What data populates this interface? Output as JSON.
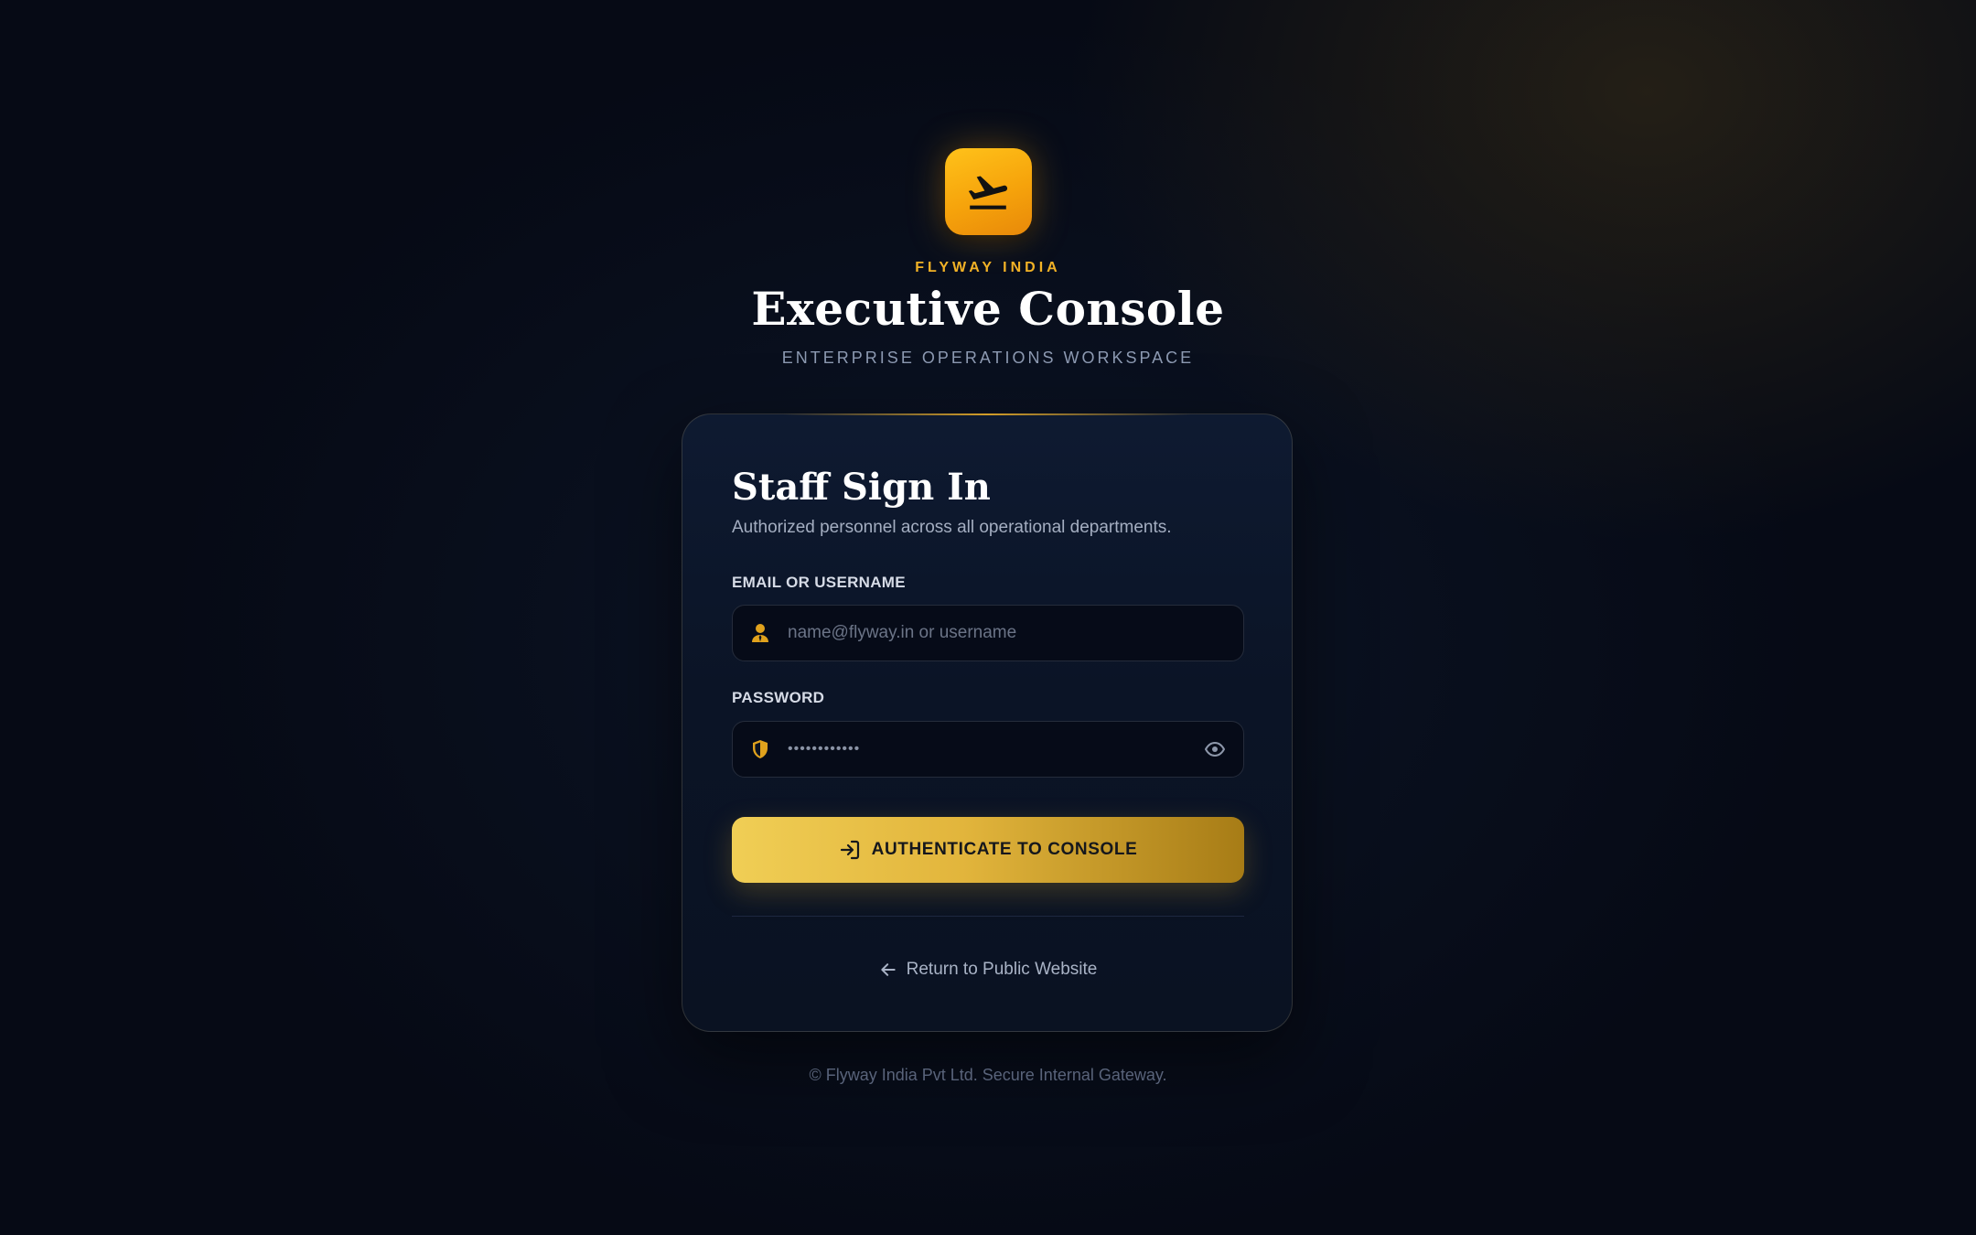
{
  "brand": {
    "name": "FLYWAY INDIA",
    "title": "Executive Console",
    "subtitle": "ENTERPRISE OPERATIONS WORKSPACE",
    "logo_icon": "plane-departure-icon"
  },
  "signin": {
    "title": "Staff Sign In",
    "description": "Authorized personnel across all operational departments.",
    "email": {
      "label": "EMAIL OR USERNAME",
      "placeholder": "name@flyway.in or username",
      "value": "",
      "icon": "user-icon"
    },
    "password": {
      "label": "PASSWORD",
      "masked_value": "••••••••••••",
      "icon": "shield-icon",
      "toggle_icon": "eye-icon"
    },
    "submit_label": "AUTHENTICATE TO CONSOLE",
    "submit_icon": "login-arrow-icon",
    "return_label": "Return to Public Website",
    "return_icon": "arrow-left-icon"
  },
  "footer": {
    "text": "© Flyway India Pvt Ltd. Secure Internal Gateway."
  },
  "colors": {
    "accent": "#f2b226",
    "background": "#060a15",
    "card": "#0b1426",
    "button_start": "#f0ce55",
    "button_end": "#a77c16"
  }
}
